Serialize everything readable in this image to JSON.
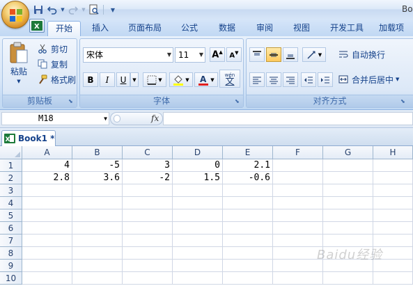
{
  "window": {
    "title_fragment": "Bo"
  },
  "quick_access": {
    "icons": [
      "save-icon",
      "undo-icon",
      "redo-icon",
      "print-preview-icon",
      "customize-icon"
    ]
  },
  "tabs": [
    "开始",
    "插入",
    "页面布局",
    "公式",
    "数据",
    "审阅",
    "视图",
    "开发工具",
    "加载项"
  ],
  "ribbon": {
    "clipboard": {
      "paste": "粘贴",
      "cut": "剪切",
      "copy": "复制",
      "format_painter": "格式刷",
      "label": "剪贴板"
    },
    "font": {
      "name": "宋体",
      "size": "11",
      "bold": "B",
      "italic": "I",
      "underline": "U",
      "phonetic": "wén",
      "phonetic_char": "文",
      "label": "字体",
      "font_color": "#e02020",
      "fill_color": "#ffff00"
    },
    "alignment": {
      "wrap": "自动换行",
      "merge": "合并后居中",
      "label": "对齐方式"
    }
  },
  "formula_bar": {
    "name_box": "M18",
    "fx": "fx",
    "formula": ""
  },
  "workbook": {
    "tab": "Book1 *"
  },
  "grid": {
    "columns": [
      "A",
      "B",
      "C",
      "D",
      "E",
      "F",
      "G",
      "H"
    ],
    "rows": [
      "1",
      "2",
      "3",
      "4",
      "5",
      "6",
      "7",
      "8",
      "9",
      "10"
    ],
    "cells": [
      [
        "4",
        "-5",
        "3",
        "0",
        "2.1",
        "",
        "",
        ""
      ],
      [
        "2.8",
        "3.6",
        "-2",
        "1.5",
        "-0.6",
        "",
        "",
        ""
      ]
    ]
  },
  "watermark": "Baidu经验"
}
